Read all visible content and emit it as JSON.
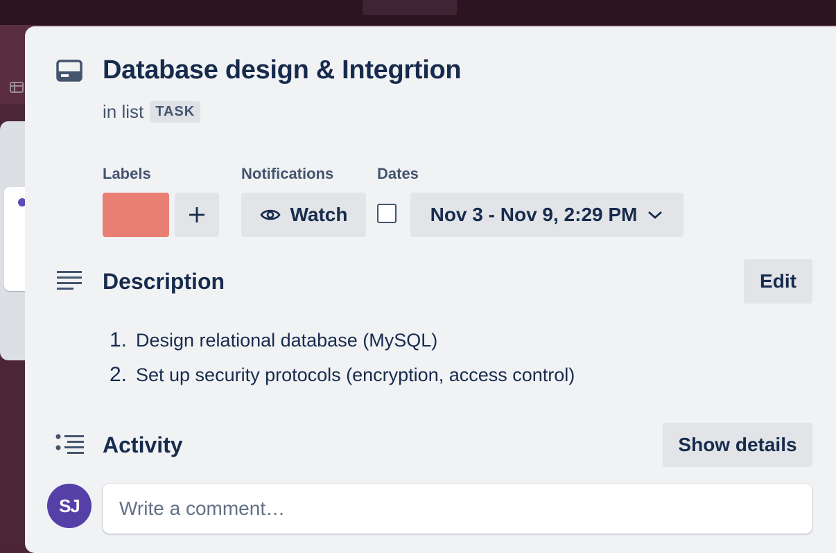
{
  "card": {
    "title": "Database design & Integrtion",
    "in_list_prefix": "in list",
    "list_name": "TASK",
    "icon": "card-icon"
  },
  "labels": {
    "heading": "Labels",
    "items": [
      {
        "color": "#e97f73"
      }
    ],
    "add_icon": "plus-icon"
  },
  "notifications": {
    "heading": "Notifications",
    "watch_label": "Watch",
    "watch_icon": "eye-icon"
  },
  "dates": {
    "heading": "Dates",
    "complete": false,
    "range_text": "Nov 3 - Nov 9, 2:29 PM",
    "dropdown_icon": "chevron-down-icon"
  },
  "description": {
    "heading": "Description",
    "icon": "description-lines-icon",
    "edit_label": "Edit",
    "items": [
      {
        "num": "1.",
        "text": "Design relational database (MySQL)"
      },
      {
        "num": "2.",
        "text": "Set up security protocols (encryption, access control)"
      }
    ]
  },
  "activity": {
    "heading": "Activity",
    "icon": "activity-list-icon",
    "show_details_label": "Show details",
    "avatar_initials": "SJ",
    "comment_placeholder": "Write a comment…"
  },
  "colors": {
    "modal_bg": "#f1f2f4",
    "button_bg": "#e2e4e8",
    "text_primary": "#172b4d",
    "avatar_bg": "#5540a8"
  }
}
